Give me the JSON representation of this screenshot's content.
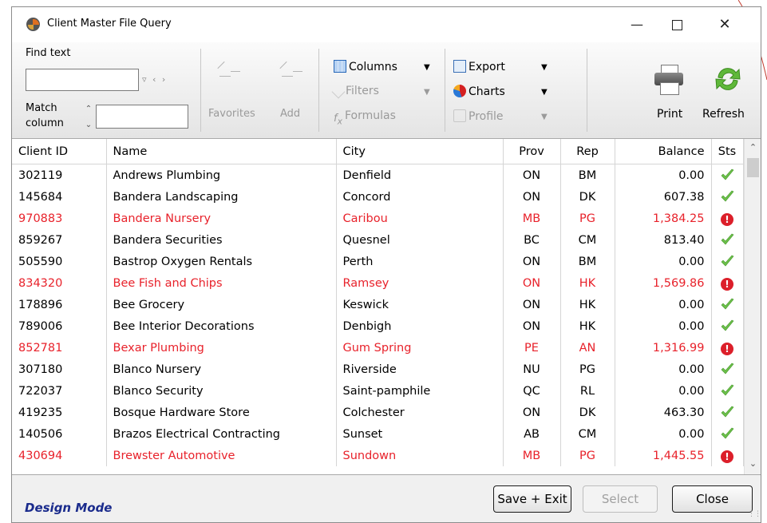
{
  "window": {
    "title": "Client Master File Query"
  },
  "toolbar": {
    "find_label": "Find text",
    "find_value": "",
    "match_label_line1": "Match",
    "match_label_line2": "column",
    "match_value": "",
    "favorites": "Favorites",
    "add": "Add",
    "columns": "Columns",
    "filters": "Filters",
    "formulas": "Formulas",
    "export": "Export",
    "charts": "Charts",
    "profile": "Profile",
    "print": "Print",
    "refresh": "Refresh"
  },
  "grid": {
    "headers": {
      "client_id": "Client ID",
      "name": "Name",
      "city": "City",
      "prov": "Prov",
      "rep": "Rep",
      "balance": "Balance",
      "sts": "Sts"
    },
    "rows": [
      {
        "id": "302119",
        "name": "Andrews Plumbing",
        "city": "Denfield",
        "prov": "ON",
        "rep": "BM",
        "balance": "0.00",
        "status": "ok"
      },
      {
        "id": "145684",
        "name": "Bandera Landscaping",
        "city": "Concord",
        "prov": "ON",
        "rep": "DK",
        "balance": "607.38",
        "status": "ok"
      },
      {
        "id": "970883",
        "name": "Bandera Nursery",
        "city": "Caribou",
        "prov": "MB",
        "rep": "PG",
        "balance": "1,384.25",
        "status": "overdue"
      },
      {
        "id": "859267",
        "name": "Bandera Securities",
        "city": "Quesnel",
        "prov": "BC",
        "rep": "CM",
        "balance": "813.40",
        "status": "ok"
      },
      {
        "id": "505590",
        "name": "Bastrop Oxygen Rentals",
        "city": "Perth",
        "prov": "ON",
        "rep": "BM",
        "balance": "0.00",
        "status": "ok"
      },
      {
        "id": "834320",
        "name": "Bee Fish and Chips",
        "city": "Ramsey",
        "prov": "ON",
        "rep": "HK",
        "balance": "1,569.86",
        "status": "overdue"
      },
      {
        "id": "178896",
        "name": "Bee Grocery",
        "city": "Keswick",
        "prov": "ON",
        "rep": "HK",
        "balance": "0.00",
        "status": "ok"
      },
      {
        "id": "789006",
        "name": "Bee Interior Decorations",
        "city": "Denbigh",
        "prov": "ON",
        "rep": "HK",
        "balance": "0.00",
        "status": "ok"
      },
      {
        "id": "852781",
        "name": "Bexar Plumbing",
        "city": "Gum Spring",
        "prov": "PE",
        "rep": "AN",
        "balance": "1,316.99",
        "status": "overdue"
      },
      {
        "id": "307180",
        "name": "Blanco Nursery",
        "city": "Riverside",
        "prov": "NU",
        "rep": "PG",
        "balance": "0.00",
        "status": "ok"
      },
      {
        "id": "722037",
        "name": "Blanco Security",
        "city": "Saint-pamphile",
        "prov": "QC",
        "rep": "RL",
        "balance": "0.00",
        "status": "ok"
      },
      {
        "id": "419235",
        "name": "Bosque Hardware Store",
        "city": "Colchester",
        "prov": "ON",
        "rep": "DK",
        "balance": "463.30",
        "status": "ok"
      },
      {
        "id": "140506",
        "name": "Brazos Electrical Contracting",
        "city": "Sunset",
        "prov": "AB",
        "rep": "CM",
        "balance": "0.00",
        "status": "ok"
      },
      {
        "id": "430694",
        "name": "Brewster Automotive",
        "city": "Sundown",
        "prov": "MB",
        "rep": "PG",
        "balance": "1,445.55",
        "status": "overdue"
      }
    ]
  },
  "footer": {
    "design_mode": "Design Mode",
    "save_exit": "Save + Exit",
    "select": "Select",
    "close": "Close"
  },
  "colors": {
    "overdue_text": "#e8222b",
    "ok_check": "#6cc04a",
    "design_mode": "#1a2b8c"
  }
}
